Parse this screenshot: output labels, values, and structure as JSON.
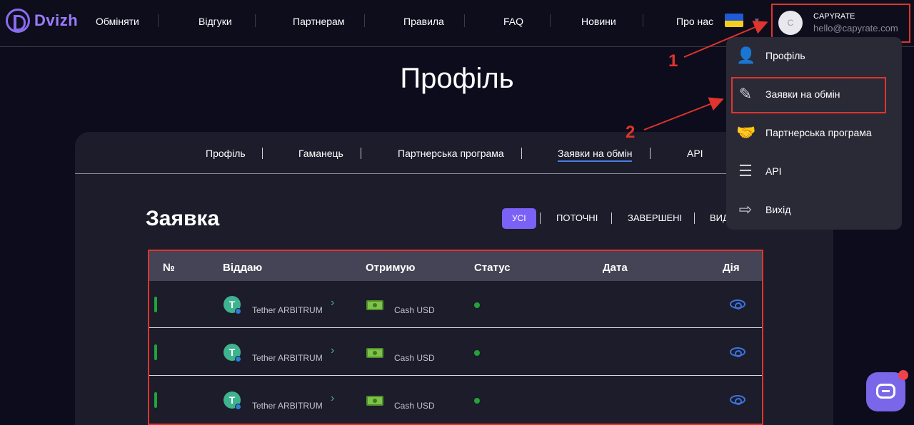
{
  "header": {
    "logo_text": "Dvizh",
    "nav": [
      "Обміняти",
      "Відгуки",
      "Партнерам",
      "Правила",
      "FAQ",
      "Новини",
      "Про нас"
    ],
    "user": {
      "avatar_letter": "C",
      "name": "CAPYRATE",
      "email": "hello@capyrate.com"
    }
  },
  "page_title": "Профіль",
  "profile_tabs": [
    "Профіль",
    "Гаманець",
    "Партнерська програма",
    "Заявки на обмін",
    "API"
  ],
  "active_tab": "Заявки на обмін",
  "section_title": "Заявка",
  "filters": [
    "УСІ",
    "ПОТОЧНІ",
    "ЗАВЕРШЕНІ",
    "ВИД"
  ],
  "table": {
    "columns": [
      "№",
      "Віддаю",
      "Отримую",
      "Статус",
      "Дата",
      "Дія"
    ],
    "rows": [
      {
        "give": "Tether ARBITRUM",
        "get": "Cash USD"
      },
      {
        "give": "Tether ARBITRUM",
        "get": "Cash USD"
      },
      {
        "give": "Tether ARBITRUM",
        "get": "Cash USD"
      }
    ]
  },
  "dropdown": {
    "items": [
      {
        "label": "Профіль",
        "icon": "user-icon"
      },
      {
        "label": "Заявки на обмін",
        "icon": "edit-document-icon"
      },
      {
        "label": "Партнерська програма",
        "icon": "handshake-icon"
      },
      {
        "label": "API",
        "icon": "document-icon"
      },
      {
        "label": "Вихід",
        "icon": "logout-icon"
      }
    ]
  },
  "annotations": [
    "1",
    "2"
  ],
  "colors": {
    "accent": "#7b61f5",
    "annotation": "#e0342c",
    "status_ok": "#22a33a",
    "link": "#4a7de8"
  }
}
